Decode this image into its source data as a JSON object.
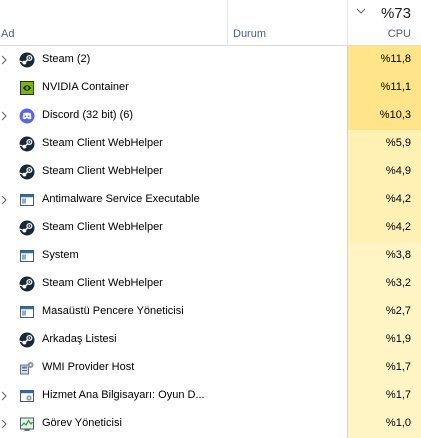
{
  "columns": {
    "name": "Ad",
    "status": "Durum",
    "cpu_total": "%73",
    "cpu_label": "CPU"
  },
  "colors": {
    "cpu_heat_high": "#ffe48a",
    "cpu_heat_mid": "#fff0b3",
    "cpu_heat_low": "#fff4c4",
    "header_label": "#4c607a"
  },
  "processes": [
    {
      "name": "Steam (2)",
      "icon": "steam-icon",
      "expandable": true,
      "cpu": "%11,8",
      "heat": "high"
    },
    {
      "name": "NVIDIA Container",
      "icon": "nvidia-icon",
      "expandable": false,
      "cpu": "%11,1",
      "heat": "high"
    },
    {
      "name": "Discord (32 bit) (6)",
      "icon": "discord-icon",
      "expandable": true,
      "cpu": "%10,3",
      "heat": "high"
    },
    {
      "name": "Steam Client WebHelper",
      "icon": "steam-icon",
      "expandable": false,
      "cpu": "%5,9",
      "heat": "mid"
    },
    {
      "name": "Steam Client WebHelper",
      "icon": "steam-icon",
      "expandable": false,
      "cpu": "%4,9",
      "heat": "mid"
    },
    {
      "name": "Antimalware Service Executable",
      "icon": "window-icon",
      "expandable": true,
      "cpu": "%4,2",
      "heat": "mid"
    },
    {
      "name": "Steam Client WebHelper",
      "icon": "steam-icon",
      "expandable": false,
      "cpu": "%4,2",
      "heat": "mid"
    },
    {
      "name": "System",
      "icon": "window-icon",
      "expandable": false,
      "cpu": "%3,8",
      "heat": "low"
    },
    {
      "name": "Steam Client WebHelper",
      "icon": "steam-icon",
      "expandable": false,
      "cpu": "%3,2",
      "heat": "low"
    },
    {
      "name": "Masaüstü Pencere Yöneticisi",
      "icon": "window-icon",
      "expandable": false,
      "cpu": "%2,7",
      "heat": "low"
    },
    {
      "name": "Arkadaş Listesi",
      "icon": "steam-icon",
      "expandable": false,
      "cpu": "%1,9",
      "heat": "low"
    },
    {
      "name": "WMI Provider Host",
      "icon": "wmi-host-icon",
      "expandable": false,
      "cpu": "%1,7",
      "heat": "low"
    },
    {
      "name": "Hizmet Ana Bilgisayarı: Oyun D...",
      "icon": "service-host-icon",
      "expandable": true,
      "cpu": "%1,7",
      "heat": "low"
    },
    {
      "name": "Görev Yöneticisi",
      "icon": "task-manager-icon",
      "expandable": true,
      "cpu": "%1,0",
      "heat": "low"
    }
  ]
}
